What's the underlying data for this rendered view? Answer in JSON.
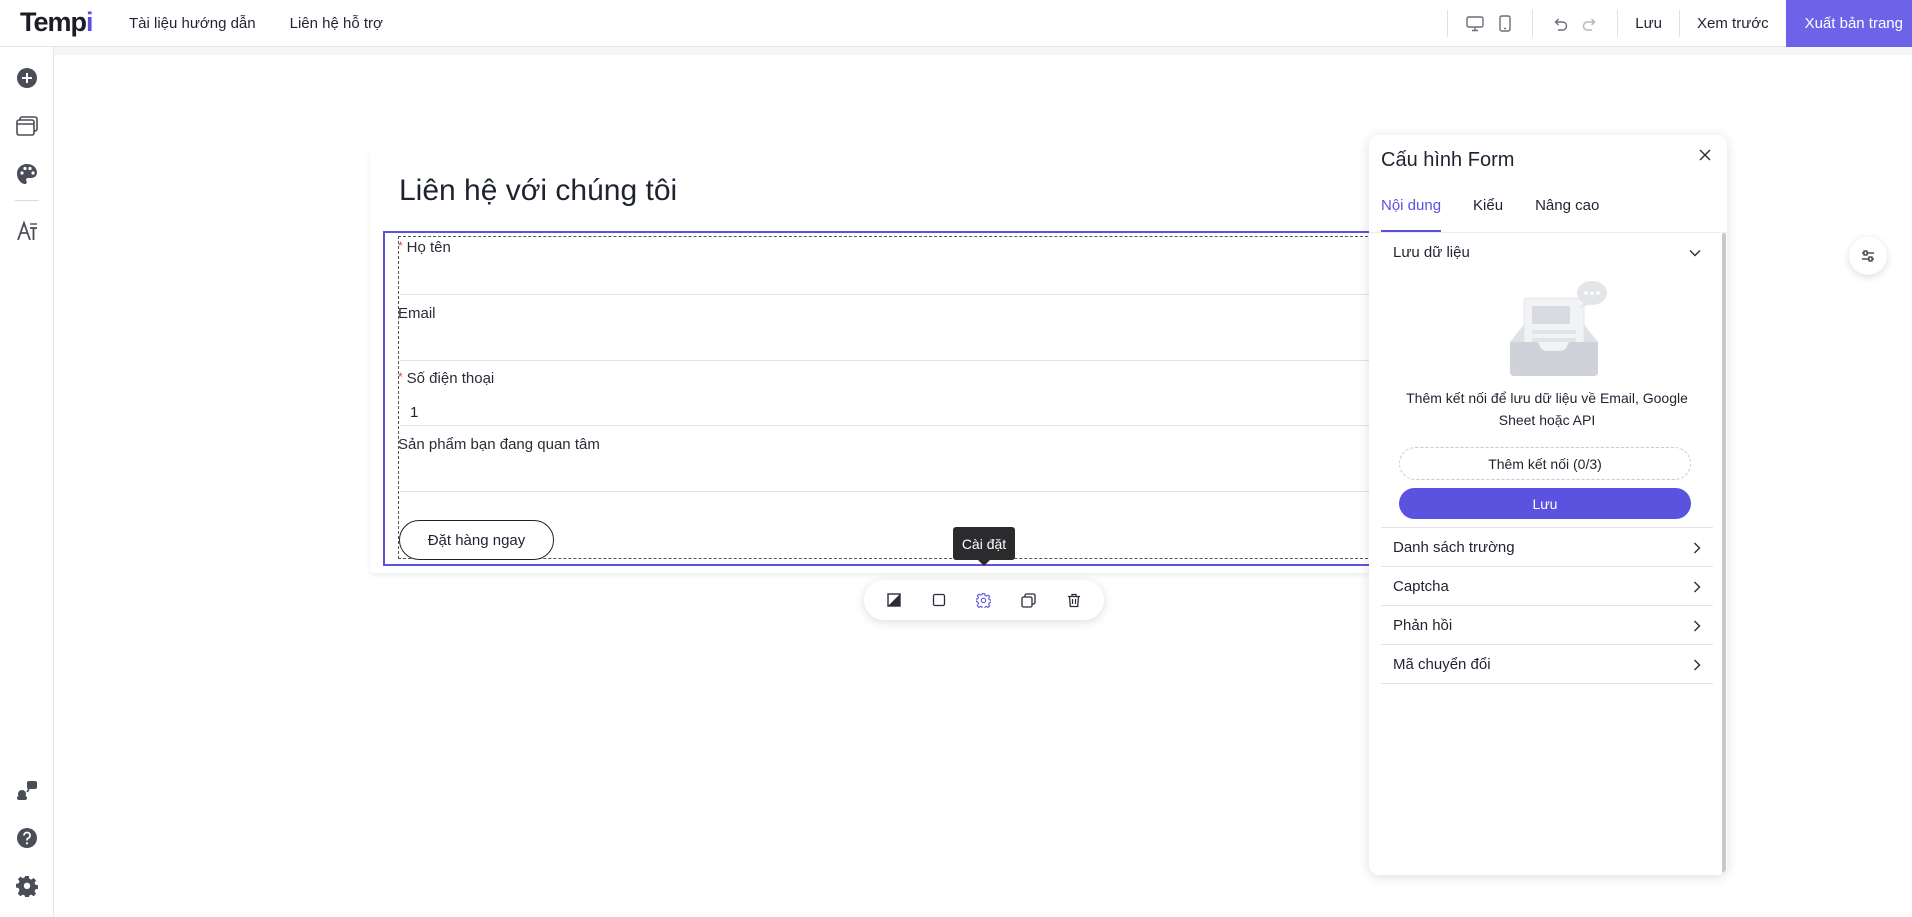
{
  "app": {
    "logo_main": "Temp",
    "logo_accent": "i"
  },
  "topnav": {
    "docs": "Tài liệu hướng dẫn",
    "support": "Liên hệ hỗ trợ"
  },
  "toolbar": {
    "save_label": "Lưu",
    "preview_label": "Xem trước",
    "publish_label": "Xuất bản trang"
  },
  "sidebar": {
    "icons": [
      "add-icon",
      "layout-icon",
      "palette-icon",
      "typography-icon",
      "integrations-icon",
      "help-icon",
      "settings-icon"
    ]
  },
  "form": {
    "title": "Liên hệ với chúng tôi",
    "fields": [
      {
        "label": "Họ tên",
        "required": true,
        "value": ""
      },
      {
        "label": "Email",
        "required": false,
        "value": ""
      },
      {
        "label": "Số điện thoại",
        "required": true,
        "value": "1"
      },
      {
        "label": "Sản phẩm bạn đang quan tâm",
        "required": false,
        "value": ""
      }
    ],
    "required_mark": "*",
    "submit_label": "Đặt hàng ngay"
  },
  "tooltip": {
    "text": "Cài đặt"
  },
  "floating_toolbar": {
    "icons": [
      "style-icon",
      "box-icon",
      "gear-icon",
      "duplicate-icon",
      "trash-icon"
    ]
  },
  "panel": {
    "title": "Cấu hình Form",
    "tabs": [
      "Nội dung",
      "Kiểu",
      "Nâng cao"
    ],
    "active_tab": "Nội dung",
    "save_data": {
      "heading": "Lưu dữ liệu",
      "empty_text": "Thêm kết nối để lưu dữ liệu về Email, Google Sheet hoặc API",
      "connect_label": "Thêm kết nối (0/3)",
      "save_label": "Lưu"
    },
    "sections": [
      "Danh sách trường",
      "Captcha",
      "Phản hồi",
      "Mã chuyển đổi"
    ]
  },
  "colors": {
    "accent": "#5b52e0",
    "publish_bg": "#6c63e8",
    "required": "#e04545"
  }
}
